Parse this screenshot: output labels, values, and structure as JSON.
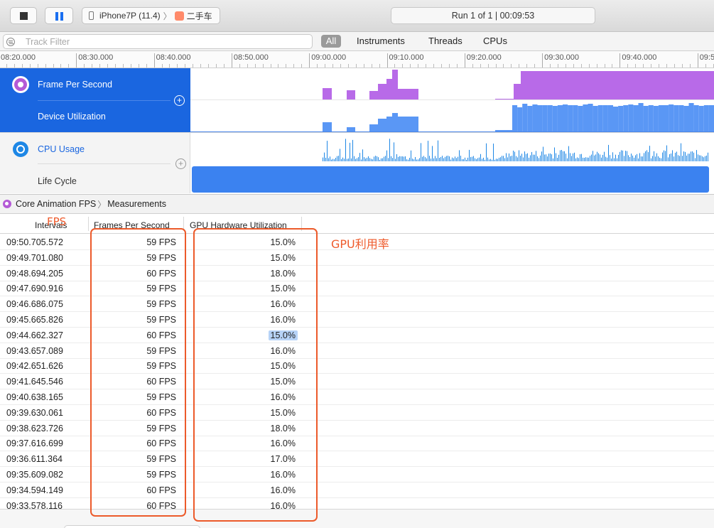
{
  "toolbar": {
    "device_label": "iPhone7P (11.4)",
    "app_label": "二手车",
    "run_status": "Run 1 of 1  |  00:09:53"
  },
  "filter": {
    "placeholder": "Track Filter",
    "scopes": [
      "All",
      "Instruments",
      "Threads",
      "CPUs"
    ]
  },
  "ruler": {
    "ticks": [
      "08:20.000",
      "08:30.000",
      "08:40.000",
      "08:50.000",
      "09:00.000",
      "09:10.000",
      "09:20.000",
      "09:30.000",
      "09:40.000",
      "09:5"
    ]
  },
  "tracks": [
    {
      "label": "Frame Per Second",
      "selected": true,
      "color": "#b86ae8"
    },
    {
      "label": "Device Utilization",
      "selected": true,
      "color": "#5a97f5"
    },
    {
      "label": "CPU Usage",
      "selected": false,
      "color": "#1e87e5"
    },
    {
      "label": "Life Cycle",
      "selected": false,
      "color": "#3b82f0"
    }
  ],
  "breadcrumb": {
    "instrument": "Core Animation FPS",
    "view": "Measurements"
  },
  "table": {
    "headers": [
      "Intervals",
      "Frames Per Second",
      "GPU Hardware Utilization"
    ],
    "rows": [
      [
        "09:50.705.572",
        "59 FPS",
        "15.0%"
      ],
      [
        "09:49.701.080",
        "59 FPS",
        "15.0%"
      ],
      [
        "09:48.694.205",
        "60 FPS",
        "18.0%"
      ],
      [
        "09:47.690.916",
        "59 FPS",
        "15.0%"
      ],
      [
        "09:46.686.075",
        "59 FPS",
        "16.0%"
      ],
      [
        "09:45.665.826",
        "59 FPS",
        "16.0%"
      ],
      [
        "09:44.662.327",
        "60 FPS",
        "15.0%"
      ],
      [
        "09:43.657.089",
        "59 FPS",
        "16.0%"
      ],
      [
        "09:42.651.626",
        "59 FPS",
        "15.0%"
      ],
      [
        "09:41.645.546",
        "60 FPS",
        "15.0%"
      ],
      [
        "09:40.638.165",
        "59 FPS",
        "16.0%"
      ],
      [
        "09:39.630.061",
        "60 FPS",
        "15.0%"
      ],
      [
        "09:38.623.726",
        "59 FPS",
        "18.0%"
      ],
      [
        "09:37.616.699",
        "60 FPS",
        "16.0%"
      ],
      [
        "09:36.611.364",
        "59 FPS",
        "17.0%"
      ],
      [
        "09:35.609.082",
        "59 FPS",
        "16.0%"
      ],
      [
        "09:34.594.149",
        "60 FPS",
        "16.0%"
      ],
      [
        "09:33.578.116",
        "60 FPS",
        "16.0%"
      ]
    ],
    "highlighted_row": 6
  },
  "annotations": {
    "fps_label": "FPS",
    "gpu_label": "GPU利用率",
    "color": "#ec5a2a"
  }
}
